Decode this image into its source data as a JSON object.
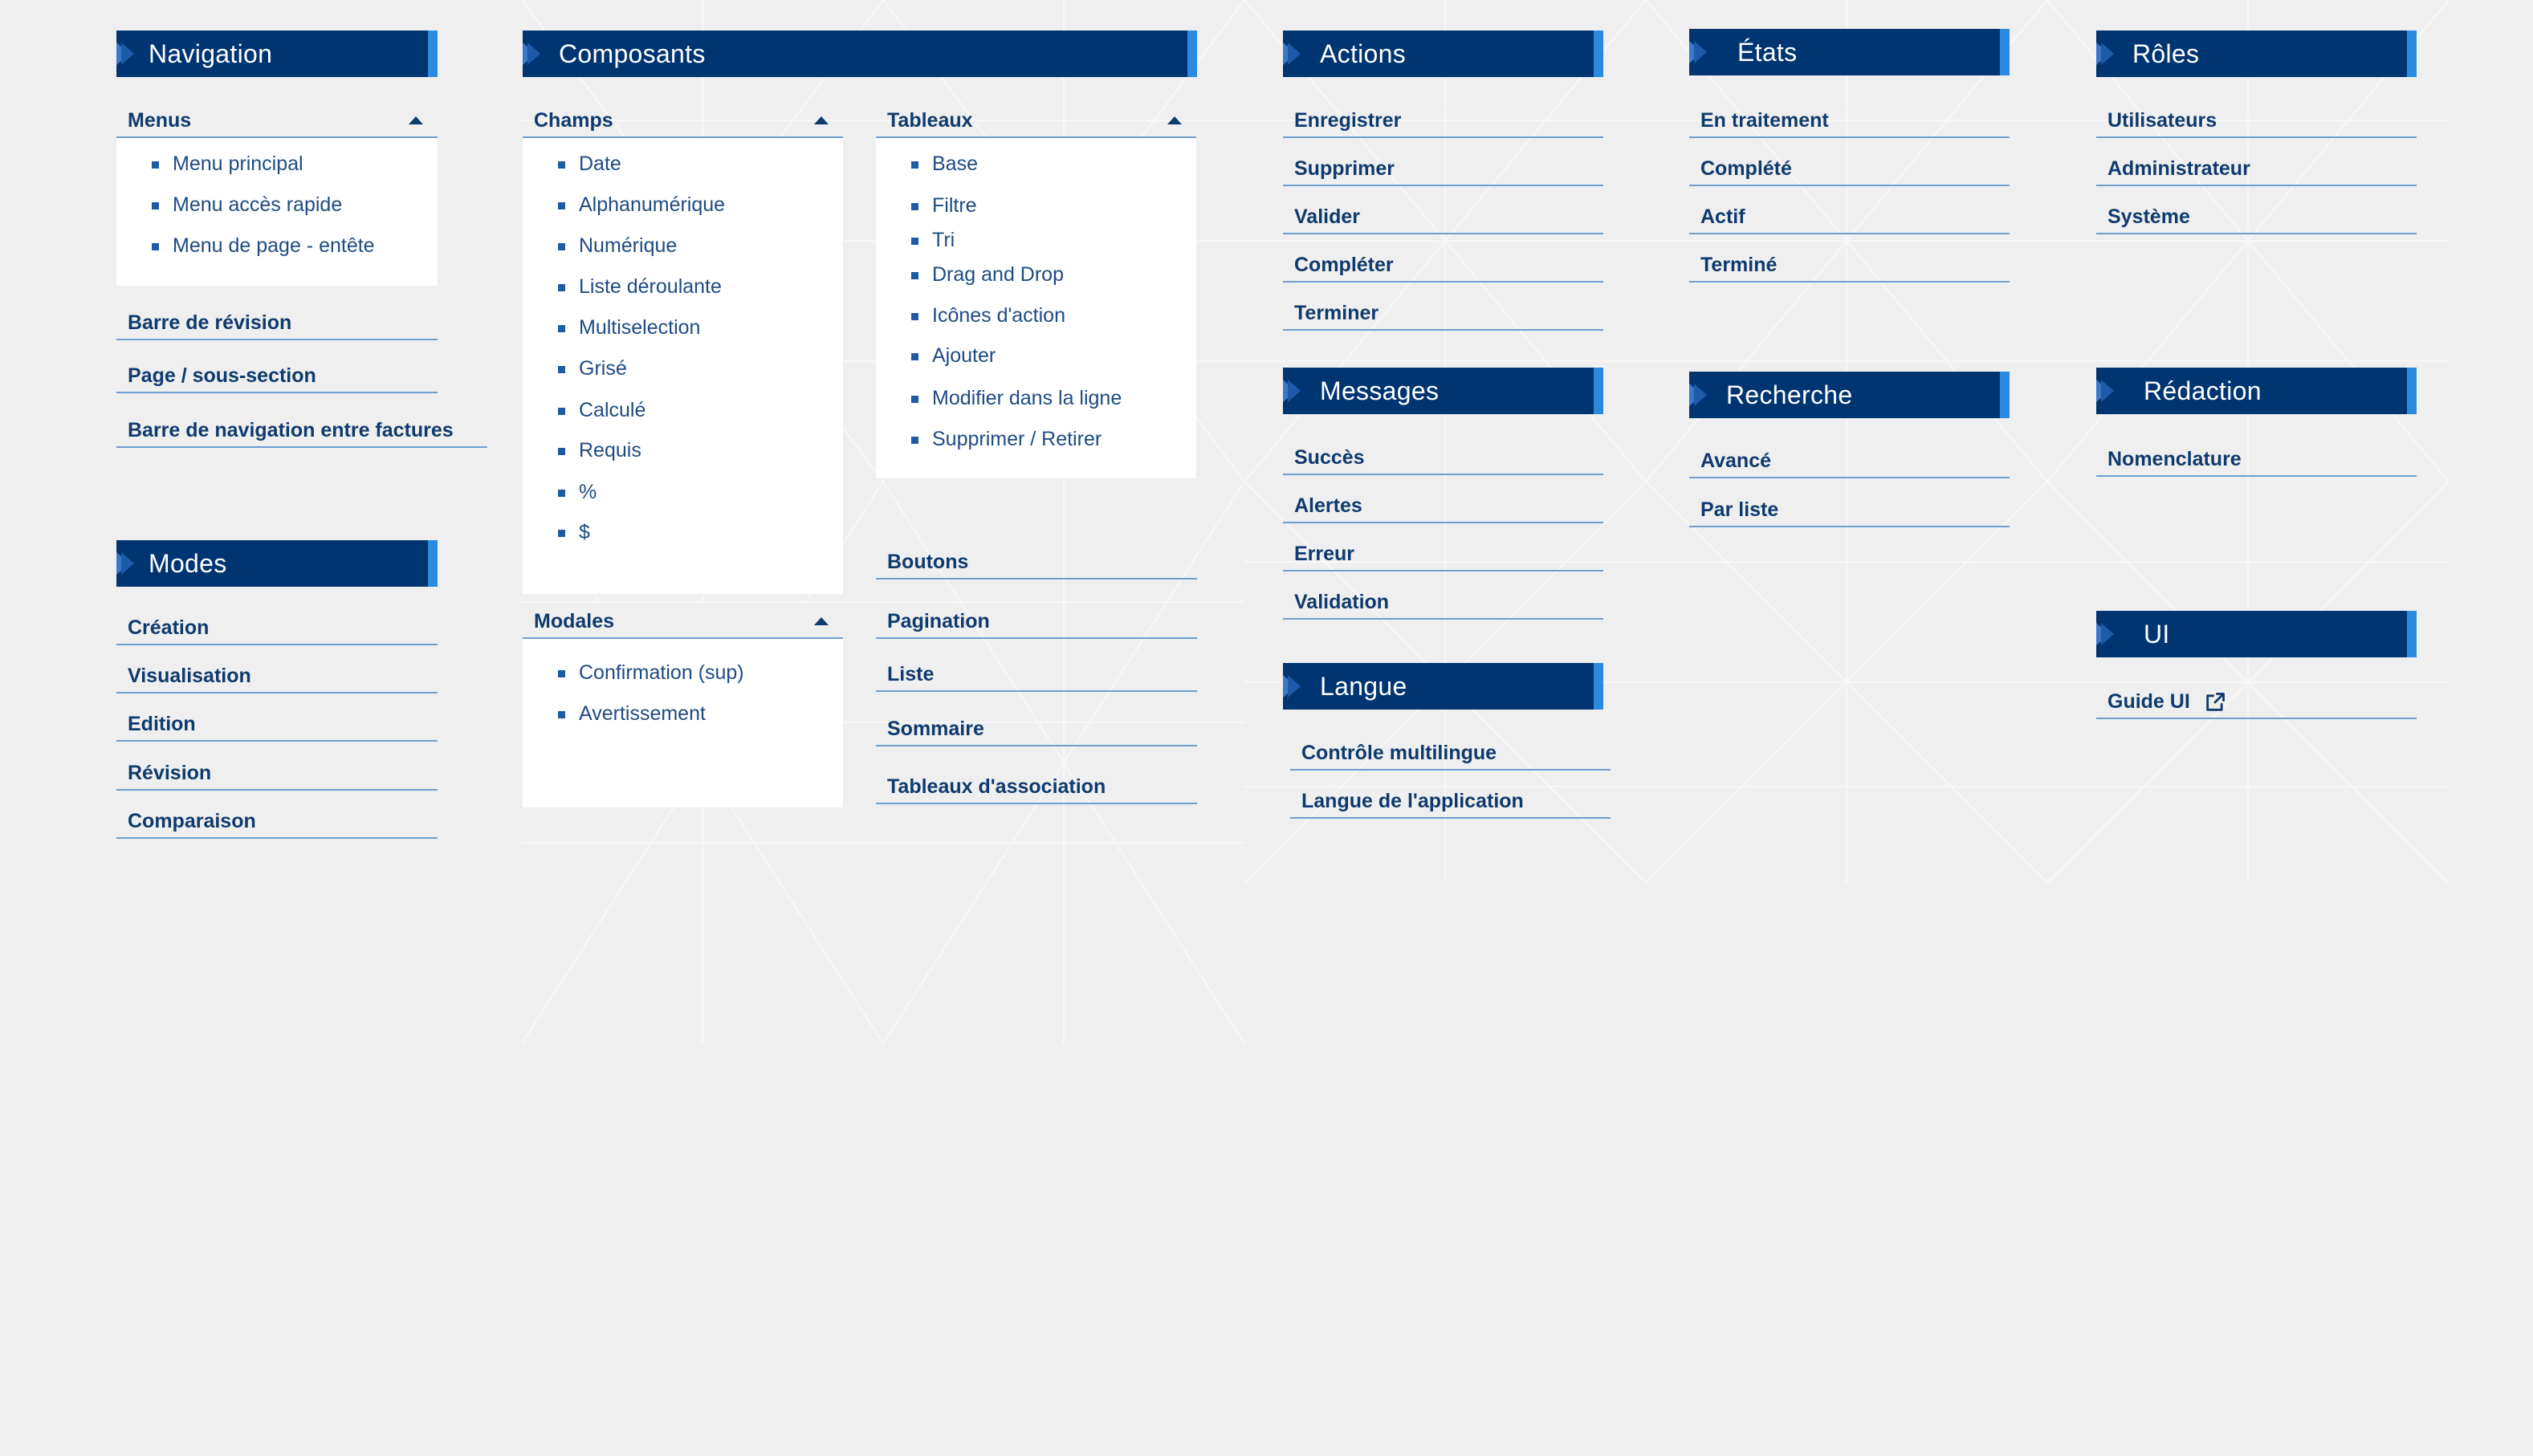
{
  "sections": {
    "navigation": "Navigation",
    "composants": "Composants",
    "actions": "Actions",
    "etats": "États",
    "roles": "Rôles",
    "modes": "Modes",
    "messages": "Messages",
    "recherche": "Recherche",
    "redaction": "Rédaction",
    "langue": "Langue",
    "ui": "UI"
  },
  "navigation": {
    "menus_label": "Menus",
    "menus": [
      "Menu principal",
      "Menu accès rapide",
      "Menu de page - entête"
    ],
    "links": [
      "Barre de révision",
      "Page / sous-section",
      "Barre de navigation entre factures"
    ]
  },
  "modes": [
    "Création",
    "Visualisation",
    "Edition",
    "Révision",
    "Comparaison"
  ],
  "composants": {
    "champs_label": "Champs",
    "champs": [
      "Date",
      "Alphanumérique",
      "Numérique",
      "Liste déroulante",
      "Multiselection",
      "Grisé",
      "Calculé",
      "Requis",
      "%",
      "$"
    ],
    "modales_label": "Modales",
    "modales": [
      "Confirmation (sup)",
      "Avertissement"
    ],
    "tableaux_label": "Tableaux",
    "tableaux": [
      "Base",
      "Filtre",
      "Tri",
      "Drag and Drop",
      "Icônes d'action",
      "Ajouter",
      "Modifier dans la ligne",
      "Supprimer / Retirer"
    ],
    "links": [
      "Boutons",
      "Pagination",
      "Liste",
      "Sommaire",
      "Tableaux d'association"
    ]
  },
  "actions": [
    "Enregistrer",
    "Supprimer",
    "Valider",
    "Compléter",
    "Terminer"
  ],
  "messages": [
    "Succès",
    "Alertes",
    "Erreur",
    "Validation"
  ],
  "langue": [
    "Contrôle multilingue",
    "Langue de l'application"
  ],
  "etats": [
    "En traitement",
    "Complété",
    "Actif",
    "Terminé"
  ],
  "recherche": [
    "Avancé",
    "Par liste"
  ],
  "roles": [
    "Utilisateurs",
    "Administrateur",
    "Système"
  ],
  "redaction": [
    "Nomenclature"
  ],
  "ui": [
    "Guide UI"
  ],
  "colors": {
    "header_bg": "#003572",
    "header_accent": "#2a8ae0",
    "link_text": "#0f3a6e",
    "underline": "#6f9fce",
    "page_bg": "#efefef"
  },
  "icons": {
    "caret": "caret-up-icon",
    "external": "external-link-icon"
  }
}
